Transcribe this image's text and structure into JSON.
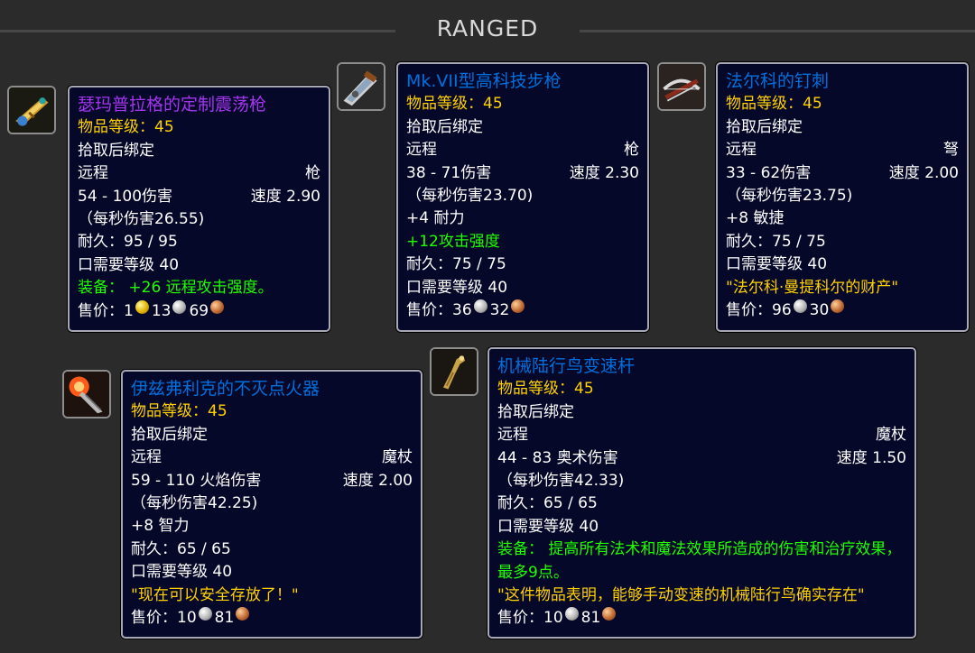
{
  "section": {
    "title": "RANGED"
  },
  "items": [
    {
      "icon": "gun-icon",
      "name": "瑟玛普拉格的定制震荡枪",
      "item_level": "物品等级：45",
      "bind": "拾取后绑定",
      "slot": "远程",
      "type": "枪",
      "damage": "54 - 100伤害",
      "speed": "速度 2.90",
      "dps": "（每秒伤害26.55)",
      "durability": "耐久：95 / 95",
      "req": "口需要等级 40",
      "equip": "装备：  +26 远程攻击强度。",
      "sell_label": "售价：",
      "gold": "1",
      "silver": "13",
      "copper": "69"
    },
    {
      "icon": "rifle-icon",
      "name": "Mk.VII型高科技步枪",
      "item_level": "物品等级：45",
      "bind": "拾取后绑定",
      "slot": "远程",
      "type": "枪",
      "damage": "38 - 71伤害",
      "speed": "速度 2.30",
      "dps": "（每秒伤害23.70)",
      "stat": "+4 耐力",
      "green_stat": "+12攻击强度",
      "durability": "耐久：75 / 75",
      "req": "口需要等级 40",
      "sell_label": "售价：",
      "silver": "36",
      "copper": "32"
    },
    {
      "icon": "crossbow-icon",
      "name": "法尔科的钉刺",
      "item_level": "物品等级：45",
      "bind": "拾取后绑定",
      "slot": "远程",
      "type": "弩",
      "damage": "33 - 62伤害",
      "speed": "速度 2.00",
      "dps": "（每秒伤害23.75)",
      "stat": "+8 敏捷",
      "durability": "耐久：75 / 75",
      "req": "口需要等级 40",
      "flavor": "\"法尔科·曼提科尔的财产\"",
      "sell_label": "售价：",
      "silver": "96",
      "copper": "30"
    },
    {
      "icon": "torch-wand-icon",
      "name": "伊兹弗利克的不灭点火器",
      "item_level": "物品等级：45",
      "bind": "拾取后绑定",
      "slot": "远程",
      "type": "魔杖",
      "damage": "59 - 110 火焰伤害",
      "speed": "速度 2.00",
      "dps": "（每秒伤害42.25)",
      "stat": "+8 智力",
      "durability": "耐久：65 / 65",
      "req": "口需要等级 40",
      "flavor": "\"现在可以安全存放了！\"",
      "sell_label": "售价：",
      "silver": "10",
      "copper": "81"
    },
    {
      "icon": "wand-icon",
      "name": "机械陆行鸟变速杆",
      "item_level": "物品等级：45",
      "bind": "拾取后绑定",
      "slot": "远程",
      "type": "魔杖",
      "damage": "44 - 83 奥术伤害",
      "speed": "速度 1.50",
      "dps": "（每秒伤害42.33)",
      "durability": "耐久：65 / 65",
      "req": "口需要等级 40",
      "equip": "装备：  提高所有法术和魔法效果所造成的伤害和治疗效果，最多9点。",
      "flavor": "\"这件物品表明，能够手动变速的机械陆行鸟确实存在\"",
      "sell_label": "售价：",
      "silver": "10",
      "copper": "81"
    }
  ]
}
